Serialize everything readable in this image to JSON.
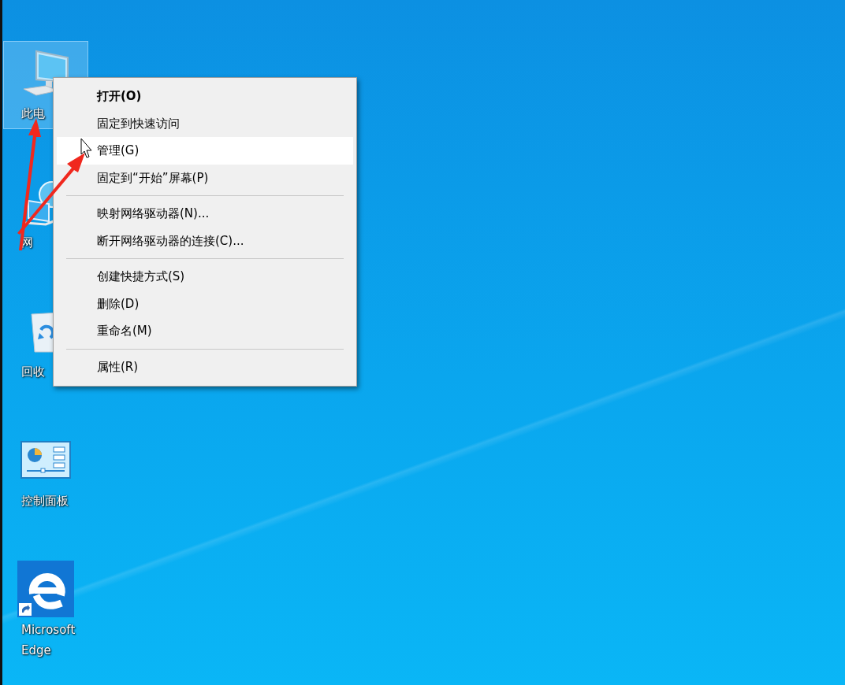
{
  "desktop_icons": [
    {
      "label": "此电",
      "kind": "computer",
      "selected": true
    },
    {
      "label": "网",
      "kind": "network",
      "selected": false
    },
    {
      "label": "回收",
      "kind": "recycle",
      "selected": false
    },
    {
      "label": "控制面板",
      "kind": "control",
      "selected": false
    },
    {
      "label": "Microsoft Edge",
      "kind": "edge",
      "selected": false
    }
  ],
  "context_menu": {
    "items": [
      {
        "kind": "item",
        "label": "打开(O)",
        "default": true,
        "selected": false
      },
      {
        "kind": "item",
        "label": "固定到快速访问",
        "default": false,
        "selected": false
      },
      {
        "kind": "item",
        "label": "管理(G)",
        "default": false,
        "selected": true
      },
      {
        "kind": "item",
        "label": "固定到“开始”屏幕(P)",
        "default": false,
        "selected": false
      },
      {
        "kind": "separator"
      },
      {
        "kind": "item",
        "label": "映射网络驱动器(N)...",
        "default": false,
        "selected": false
      },
      {
        "kind": "item",
        "label": "断开网络驱动器的连接(C)...",
        "default": false,
        "selected": false
      },
      {
        "kind": "separator"
      },
      {
        "kind": "item",
        "label": "创建快捷方式(S)",
        "default": false,
        "selected": false
      },
      {
        "kind": "item",
        "label": "删除(D)",
        "default": false,
        "selected": false
      },
      {
        "kind": "item",
        "label": "重命名(M)",
        "default": false,
        "selected": false
      },
      {
        "kind": "separator"
      },
      {
        "kind": "item",
        "label": "属性(R)",
        "default": false,
        "selected": false
      }
    ]
  }
}
